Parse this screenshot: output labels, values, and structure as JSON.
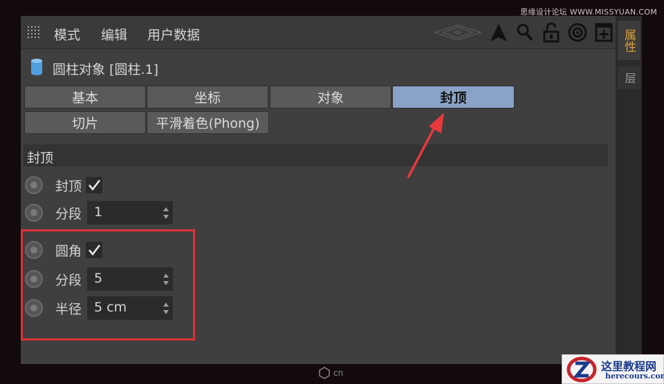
{
  "watermark_top": "思缘设计论坛 WWW.MISSYUAN.COM",
  "menu": [
    "模式",
    "编辑",
    "用户数据"
  ],
  "object": {
    "title": "圆柱对象 [圆柱.1]",
    "icon": "cylinder-icon"
  },
  "tabs": [
    {
      "label": "基本",
      "active": false
    },
    {
      "label": "坐标",
      "active": false
    },
    {
      "label": "对象",
      "active": false
    },
    {
      "label": "封顶",
      "active": true
    },
    {
      "label": "切片",
      "active": false
    },
    {
      "label": "平滑着色(Phong)",
      "active": false
    }
  ],
  "section": {
    "title": "封顶"
  },
  "fields": {
    "cap": {
      "label": "封顶",
      "checked": true
    },
    "cap_segments": {
      "label": "分段",
      "value": "1"
    },
    "fillet": {
      "label": "圆角",
      "checked": true
    },
    "fillet_segments": {
      "label": "分段",
      "value": "5"
    },
    "radius": {
      "label": "半径",
      "value": "5 cm"
    }
  },
  "right_tabs": [
    "属性",
    "层"
  ],
  "bottom_watermark": "cn",
  "logo": {
    "line1": "这里教程网",
    "line2": "herecours.com"
  },
  "colors": {
    "active_tab": "#8aa2c6",
    "highlight_box": "#e03236",
    "arrow": "#e8393c",
    "right_tab_text": "#e0a13a"
  }
}
